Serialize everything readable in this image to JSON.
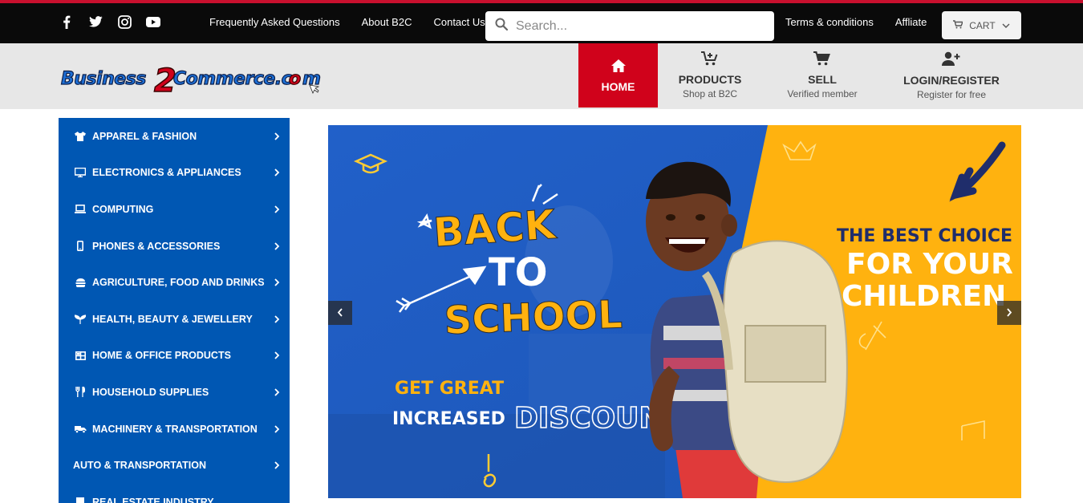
{
  "topbar": {
    "social": [
      "facebook-icon",
      "twitter-icon",
      "instagram-icon",
      "youtube-icon"
    ],
    "links_left": [
      "Frequently Asked Questions",
      "About B2C",
      "Contact Us"
    ],
    "search_placeholder": "Search...",
    "links_right": [
      "Terms & conditions",
      "Affliate"
    ],
    "cart_label": "CART"
  },
  "header": {
    "logo_text": "Business2Commerce.com",
    "nav": [
      {
        "title": "HOME",
        "sub": "",
        "icon": "home-icon"
      },
      {
        "title": "PRODUCTS",
        "sub": "Shop at B2C",
        "icon": "cart-add-icon"
      },
      {
        "title": "SELL",
        "sub": "Verified member",
        "icon": "cart-icon"
      },
      {
        "title": "LOGIN/REGISTER",
        "sub": "Register for free",
        "icon": "user-add-icon"
      }
    ]
  },
  "sidebar": {
    "categories": [
      {
        "label": "APPAREL & FASHION",
        "icon": "tshirt-icon"
      },
      {
        "label": "ELECTRONICS & APPLIANCES",
        "icon": "monitor-icon"
      },
      {
        "label": "COMPUTING",
        "icon": "laptop-icon"
      },
      {
        "label": "PHONES & ACCESSORIES",
        "icon": "phone-icon"
      },
      {
        "label": "AGRICULTURE, FOOD AND DRINKS",
        "icon": "food-icon"
      },
      {
        "label": "HEALTH, BEAUTY & JEWELLERY",
        "icon": "beauty-icon"
      },
      {
        "label": "HOME & OFFICE PRODUCTS",
        "icon": "office-icon"
      },
      {
        "label": "HOUSEHOLD SUPPLIES",
        "icon": "utensils-icon"
      },
      {
        "label": "MACHINERY & TRANSPORTATION",
        "icon": "truck-icon"
      },
      {
        "label": "AUTO & TRANSPORTATION",
        "icon": ""
      },
      {
        "label": "REAL ESTATE INDUSTRY",
        "icon": "building-icon"
      }
    ]
  },
  "banner": {
    "headline_1": "BACK",
    "headline_2": "TO",
    "headline_3": "SCHOOL",
    "tag_1": "GET GREAT",
    "tag_2": "INCREASED",
    "tag_3": "DISCOUNTS",
    "right_1": "THE BEST CHOICE",
    "right_2": "FOR YOUR",
    "right_3": "CHILDREN",
    "colors": {
      "blue": "#1a5bc4",
      "yellow": "#ffb20f",
      "navy": "#1f2d6b"
    }
  },
  "colors": {
    "accent_red": "#d0021b",
    "sidebar_blue": "#0057b3",
    "top_black": "#0a0a0a"
  }
}
